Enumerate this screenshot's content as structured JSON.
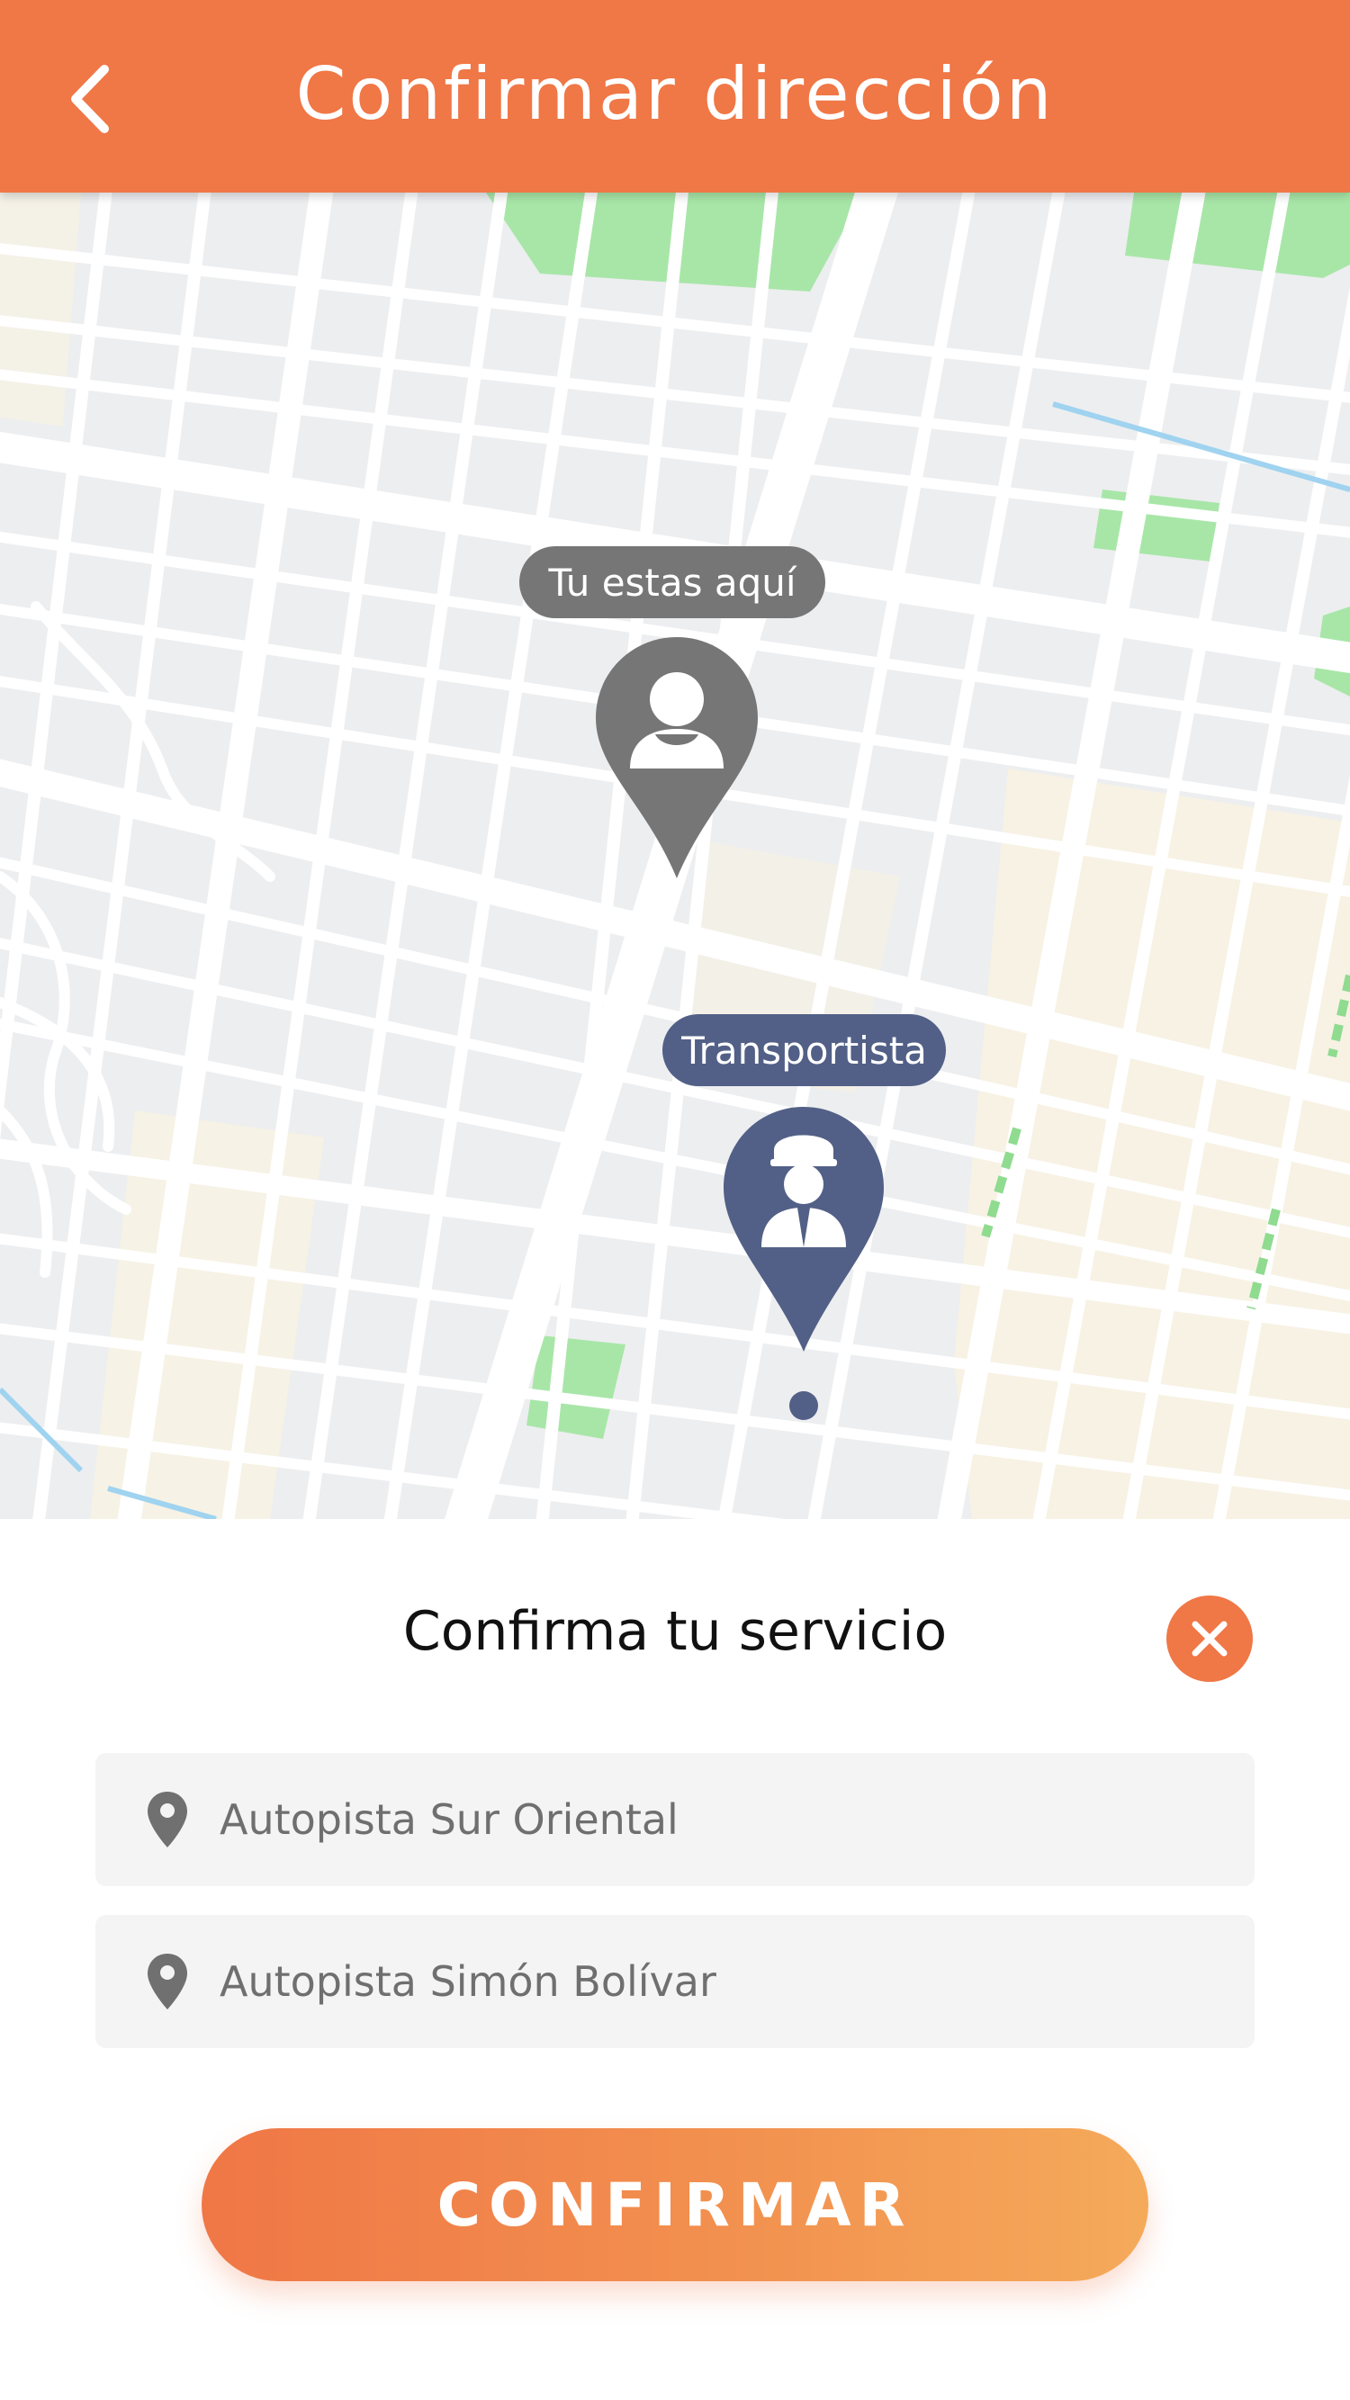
{
  "header": {
    "title": "Confirmar dirección",
    "back_icon": "chevron-left-icon"
  },
  "map": {
    "user_marker_label": "Tu estas aquí",
    "driver_marker_label": "Transportista",
    "user_marker_icon": "user-pin-icon",
    "driver_marker_icon": "driver-pin-icon",
    "user_marker_color": "#767676",
    "driver_marker_color": "#526087"
  },
  "sheet": {
    "title": "Confirma tu servicio",
    "close_icon": "close-icon",
    "origin": "Autopista Sur Oriental",
    "destination": "Autopista Simón Bolívar",
    "confirm_label": "CONFIRMAR"
  },
  "colors": {
    "accent": "#f07746",
    "field_background": "#f4f4f4"
  }
}
